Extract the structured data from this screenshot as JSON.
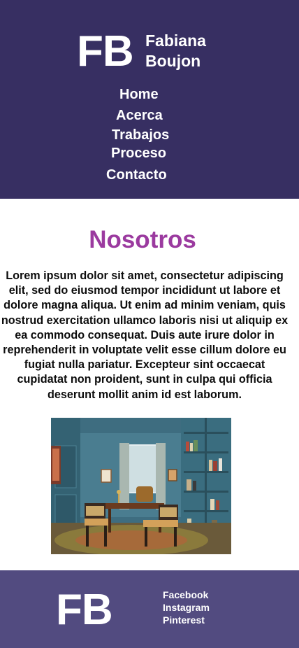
{
  "header": {
    "logo_initials": "FB",
    "logo_name_line1": "Fabiana",
    "logo_name_line2": "Boujon",
    "nav": [
      "Home",
      "Acerca",
      "Trabajos",
      "Proceso",
      "Contacto"
    ]
  },
  "main": {
    "title": "Nosotros",
    "paragraph": "Lorem ipsum dolor sit amet, consectetur adipiscing elit, sed do eiusmod tempor incididunt ut labore et dolore magna aliqua. Ut enim ad minim veniam, quis nostrud exercitation ullamco laboris nisi ut aliquip ex ea commodo consequat. Duis aute irure dolor in reprehenderit in voluptate velit esse cillum dolore eu fugiat nulla pariatur. Excepteur sint occaecat cupidatat non proident, sunt in culpa qui officia deserunt mollit anim id est laborum."
  },
  "footer": {
    "logo_initials": "FB",
    "social": [
      "Facebook",
      "Instagram",
      "Pinterest"
    ]
  },
  "colors": {
    "header_bg": "#372f62",
    "footer_bg": "#524b80",
    "title_accent": "#9b3a9f",
    "text": "#0c0c0c"
  }
}
